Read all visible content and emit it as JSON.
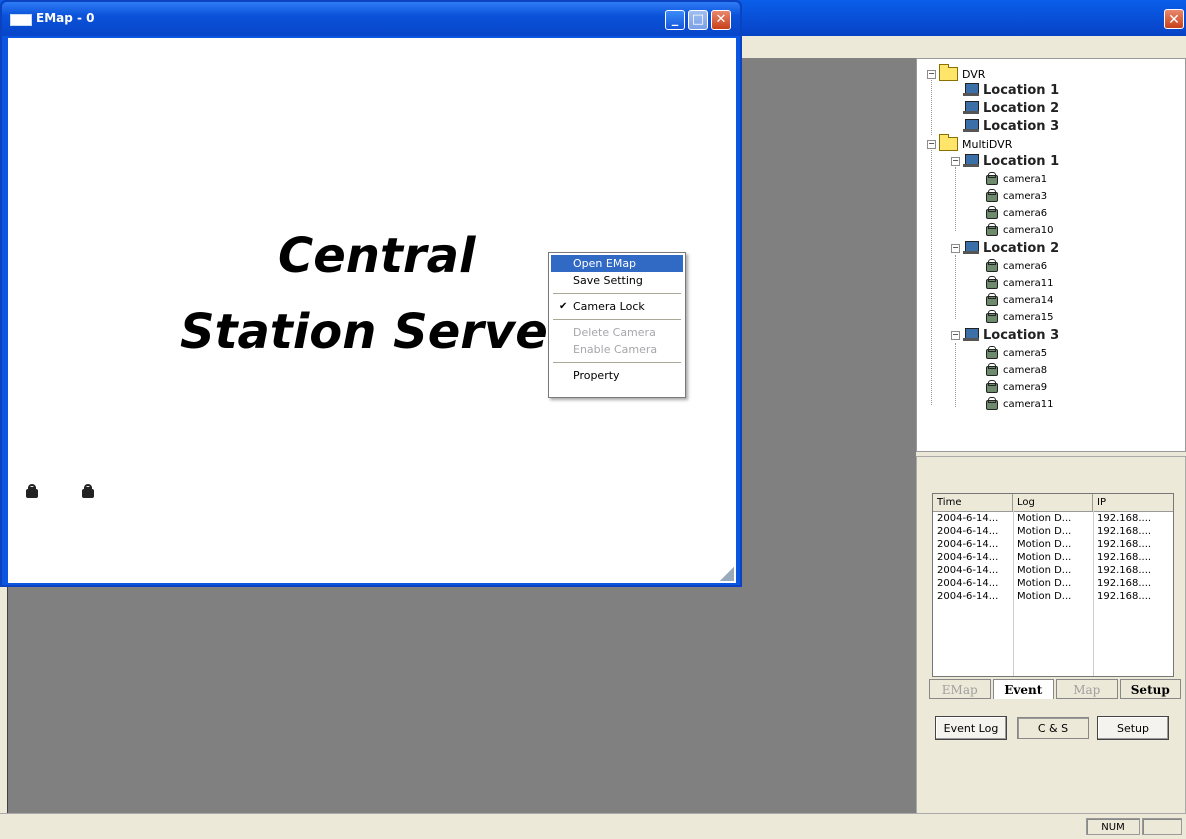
{
  "emap_window": {
    "title": "EMap - 0",
    "map_text_line1": "Central",
    "map_text_line2": "Station Server",
    "window_buttons": [
      "minimize",
      "maximize",
      "close"
    ]
  },
  "context_menu": {
    "items": [
      {
        "label": "Open EMap",
        "state": "highlighted"
      },
      {
        "label": "Save Setting",
        "state": "enabled"
      },
      {
        "label": "Camera Lock",
        "state": "checked"
      },
      {
        "label": "Delete Camera",
        "state": "disabled"
      },
      {
        "label": "Enable Camera",
        "state": "disabled"
      },
      {
        "label": "Property",
        "state": "enabled"
      }
    ]
  },
  "tree": {
    "dvr": {
      "label": "DVR",
      "locations": [
        "Location 1",
        "Location 2",
        "Location 3"
      ]
    },
    "multidvr": {
      "label": "MultiDVR",
      "locations": [
        {
          "label": "Location 1",
          "cameras": [
            "camera1",
            "camera3",
            "camera6",
            "camera10"
          ]
        },
        {
          "label": "Location 2",
          "cameras": [
            "camera6",
            "camera11",
            "camera14",
            "camera15"
          ]
        },
        {
          "label": "Location 3",
          "cameras": [
            "camera5",
            "camera8",
            "camera9",
            "camera11"
          ]
        }
      ]
    }
  },
  "event_table": {
    "columns": [
      "Time",
      "Log",
      "IP"
    ],
    "rows": [
      [
        "2004-6-14...",
        "Motion D...",
        "192.168...."
      ],
      [
        "2004-6-14...",
        "Motion D...",
        "192.168...."
      ],
      [
        "2004-6-14...",
        "Motion D...",
        "192.168...."
      ],
      [
        "2004-6-14...",
        "Motion D...",
        "192.168...."
      ],
      [
        "2004-6-14...",
        "Motion D...",
        "192.168...."
      ],
      [
        "2004-6-14...",
        "Motion D...",
        "192.168...."
      ],
      [
        "2004-6-14...",
        "Motion D...",
        "192.168...."
      ]
    ]
  },
  "tabs": [
    {
      "label": "EMap",
      "state": "disabled"
    },
    {
      "label": "Event",
      "state": "active"
    },
    {
      "label": "Map",
      "state": "disabled"
    },
    {
      "label": "Setup",
      "state": "bold"
    }
  ],
  "bottom_controls": {
    "event_log_button": "Event Log",
    "mode_box": "C & S",
    "setup_button": "Setup"
  },
  "statusbar": {
    "num_indicator": "NUM"
  },
  "colors": {
    "title_blue": "#0A52DA",
    "menu_highlight": "#316AC5",
    "workspace_gray": "#808080",
    "face": "#ECE9D8"
  }
}
